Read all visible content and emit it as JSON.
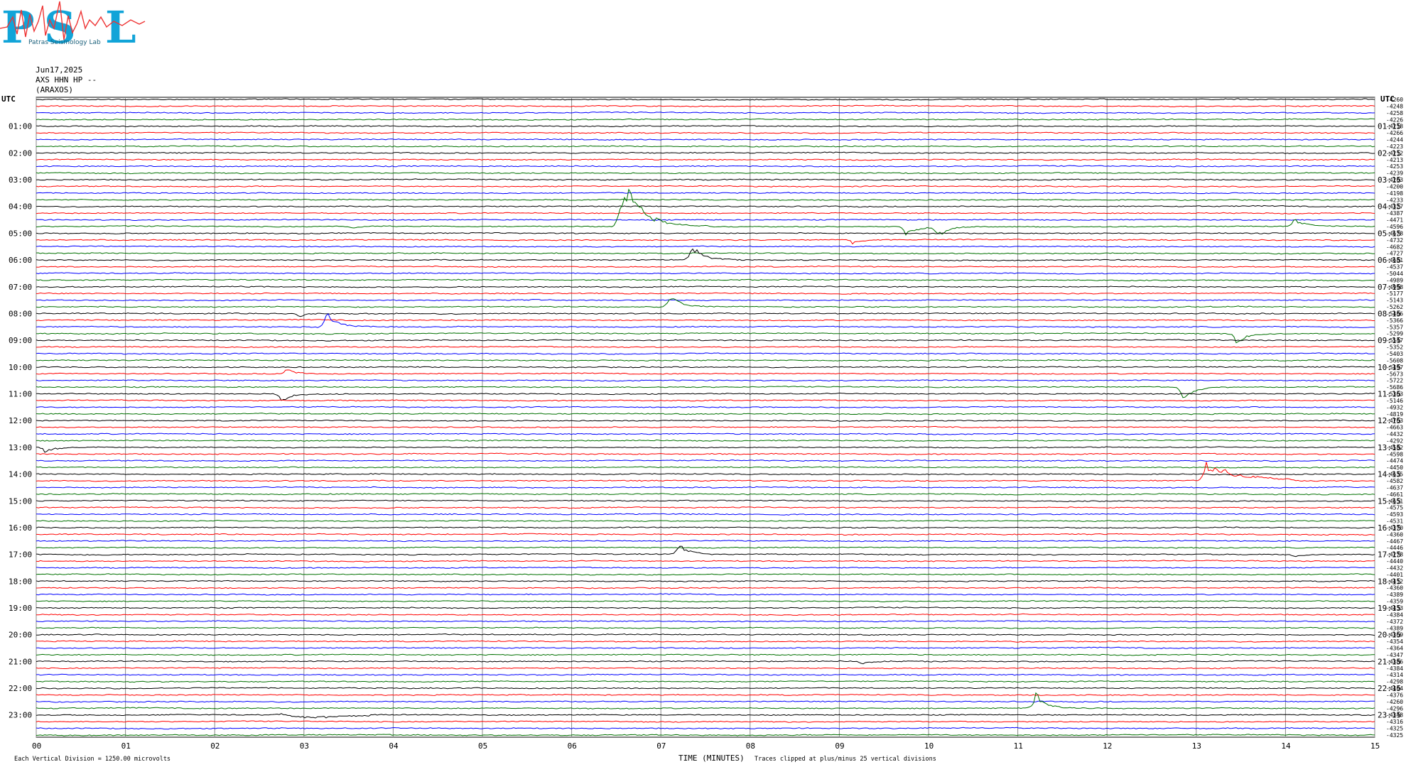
{
  "header": {
    "logo_text": "PSL",
    "logo_subtext": "Patras Seismology Lab",
    "date": "Jun17,2025",
    "channel": "AXS HHN HP --",
    "station": "(ARAXOS)"
  },
  "chart_data": {
    "type": "line",
    "title": "",
    "left_axis_title": "UTC",
    "right_axis_title": "UTC",
    "xlabel": "TIME (MINUTES)",
    "x_ticks": [
      "00",
      "01",
      "02",
      "03",
      "04",
      "05",
      "06",
      "07",
      "08",
      "09",
      "10",
      "11",
      "12",
      "13",
      "14",
      "15"
    ],
    "xlim": [
      0,
      15
    ],
    "left_hour_labels": [
      "01:00",
      "02:00",
      "03:00",
      "04:00",
      "05:00",
      "06:00",
      "07:00",
      "08:00",
      "09:00",
      "10:00",
      "11:00",
      "12:00",
      "13:00",
      "14:00",
      "15:00",
      "16:00",
      "17:00",
      "18:00",
      "19:00",
      "20:00",
      "21:00",
      "22:00",
      "23:00"
    ],
    "right_hour_labels": [
      "01:15",
      "02:15",
      "03:15",
      "04:15",
      "05:15",
      "06:15",
      "07:15",
      "08:15",
      "09:15",
      "10:15",
      "11:15",
      "12:15",
      "13:15",
      "14:15",
      "15:15",
      "16:15",
      "17:15",
      "18:15",
      "19:15",
      "20:15",
      "21:15",
      "22:15",
      "23:15"
    ],
    "trace_colors": [
      "#000000",
      "#ff0000",
      "#0000ff",
      "#007000"
    ],
    "trace_count": 96,
    "trace_offsets": [
      -4260,
      -4248,
      -4258,
      -4226,
      -4218,
      -4266,
      -4244,
      -4223,
      -4212,
      -4213,
      -4253,
      -4239,
      -4203,
      -4200,
      -4198,
      -4233,
      -4327,
      -4387,
      -4471,
      -4596,
      -4678,
      -4732,
      -4682,
      -4727,
      -4681,
      -4537,
      -5044,
      -4989,
      -4998,
      -5177,
      -5143,
      -5262,
      -5406,
      -5366,
      -5357,
      -5299,
      -5547,
      -5352,
      -5403,
      -5608,
      -5497,
      -5673,
      -5722,
      -5686,
      -5363,
      -5146,
      -4932,
      -4819,
      -4763,
      -4663,
      -4432,
      -4292,
      -4582,
      -4598,
      -4474,
      -4450,
      -4635,
      -4582,
      -4637,
      -4661,
      -4651,
      -4575,
      -4593,
      -4531,
      -4370,
      -4360,
      -4467,
      -4446,
      -4278,
      -4440,
      -4432,
      -4401,
      -4412,
      -4360,
      -4389,
      -4359,
      -4433,
      -4384,
      -4372,
      -4389,
      -4369,
      -4354,
      -4364,
      -4347,
      -4386,
      -4384,
      -4314,
      -4298,
      -4404,
      -4376,
      -4260,
      -4296,
      -4348,
      -4316,
      -4325,
      -4325
    ],
    "events": [
      {
        "trace": 19,
        "minute": 3.55,
        "amplitude": 1.2
      },
      {
        "trace": 19,
        "minute": 6.55,
        "amplitude": 3.0
      },
      {
        "trace": 19,
        "minute": 6.65,
        "amplitude": 2.4
      },
      {
        "trace": 19,
        "minute": 9.75,
        "amplitude": 1.0
      },
      {
        "trace": 19,
        "minute": 10.1,
        "amplitude": 1.0
      },
      {
        "trace": 19,
        "minute": 14.1,
        "amplitude": 0.9
      },
      {
        "trace": 21,
        "minute": 9.15,
        "amplitude": 0.7
      },
      {
        "trace": 24,
        "minute": 7.35,
        "amplitude": 1.5
      },
      {
        "trace": 31,
        "minute": 7.1,
        "amplitude": 1.3
      },
      {
        "trace": 32,
        "minute": 2.95,
        "amplitude": 1.8
      },
      {
        "trace": 34,
        "minute": 3.25,
        "amplitude": 1.6
      },
      {
        "trace": 35,
        "minute": 13.45,
        "amplitude": 1.3
      },
      {
        "trace": 41,
        "minute": 2.8,
        "amplitude": 0.7
      },
      {
        "trace": 43,
        "minute": 12.85,
        "amplitude": 1.5
      },
      {
        "trace": 44,
        "minute": 2.75,
        "amplitude": 1.0
      },
      {
        "trace": 52,
        "minute": 0.1,
        "amplitude": 0.6
      },
      {
        "trace": 57,
        "minute": 13.1,
        "amplitude": 3.2
      },
      {
        "trace": 68,
        "minute": 7.2,
        "amplitude": 1.1
      },
      {
        "trace": 68,
        "minute": 14.1,
        "amplitude": 0.8
      },
      {
        "trace": 84,
        "minute": 9.25,
        "amplitude": 0.8
      },
      {
        "trace": 91,
        "minute": 11.2,
        "amplitude": 1.4
      },
      {
        "trace": 92,
        "minute": 2.75,
        "amplitude": 4.0
      }
    ],
    "footer_left": "Each Vertical Division = 1250.00 microvolts",
    "footer_right": "Traces clipped at plus/minus 25 vertical divisions",
    "grid": true
  }
}
